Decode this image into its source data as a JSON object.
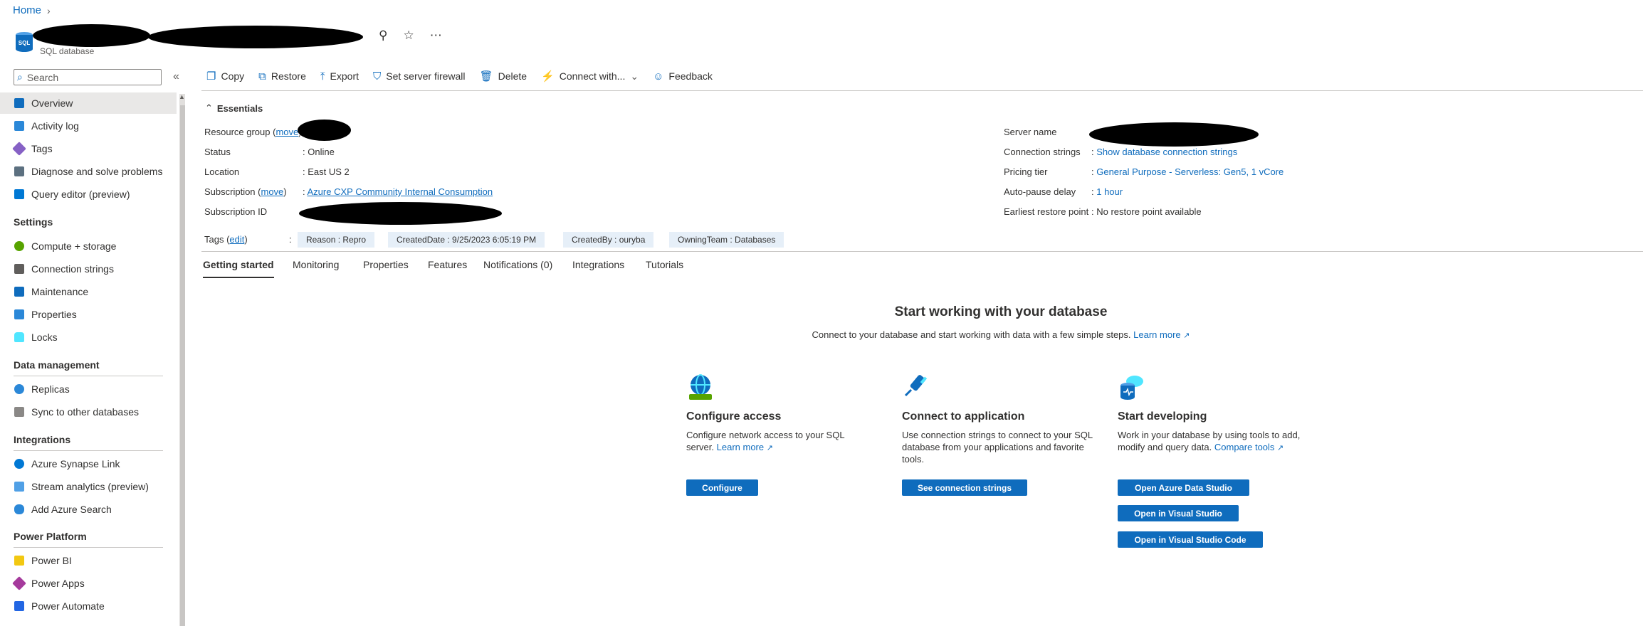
{
  "breadcrumb": {
    "home": "Home"
  },
  "resource": {
    "type_label": "SQL database"
  },
  "sidebar": {
    "search_placeholder": "Search",
    "top_items": [
      {
        "label": "Overview",
        "icon": "sql-icon"
      },
      {
        "label": "Activity log",
        "icon": "log-icon"
      },
      {
        "label": "Tags",
        "icon": "tag-icon"
      },
      {
        "label": "Diagnose and solve problems",
        "icon": "wrench-icon"
      },
      {
        "label": "Query editor (preview)",
        "icon": "query-icon"
      }
    ],
    "sections": [
      {
        "title": "Settings",
        "items": [
          "Compute + storage",
          "Connection strings",
          "Maintenance",
          "Properties",
          "Locks"
        ]
      },
      {
        "title": "Data management",
        "items": [
          "Replicas",
          "Sync to other databases"
        ]
      },
      {
        "title": "Integrations",
        "items": [
          "Azure Synapse Link",
          "Stream analytics (preview)",
          "Add Azure Search"
        ]
      },
      {
        "title": "Power Platform",
        "items": [
          "Power BI",
          "Power Apps",
          "Power Automate"
        ]
      }
    ]
  },
  "toolbar": {
    "copy": "Copy",
    "restore": "Restore",
    "export": "Export",
    "firewall": "Set server firewall",
    "delete": "Delete",
    "connect": "Connect with...",
    "feedback": "Feedback"
  },
  "essentials": {
    "heading": "Essentials",
    "resource_group_label": "Resource group",
    "move": "move",
    "status_label": "Status",
    "status": "Online",
    "location_label": "Location",
    "location": "East US 2",
    "subscription_label": "Subscription",
    "subscription": "Azure CXP Community Internal Consumption",
    "subscription_id_label": "Subscription ID",
    "server_name_label": "Server name",
    "conn_label": "Connection strings",
    "conn": "Show database connection strings",
    "pricing_label": "Pricing tier",
    "pricing": "General Purpose - Serverless: Gen5, 1 vCore",
    "autopause_label": "Auto-pause delay",
    "autopause": "1 hour",
    "restore_label": "Earliest restore point",
    "restore": "No restore point available",
    "tags_label": "Tags",
    "edit": "edit",
    "tags": [
      "Reason : Repro",
      "CreatedDate : 9/25/2023 6:05:19 PM",
      "CreatedBy : ouryba",
      "OwningTeam : Databases"
    ]
  },
  "tabs": [
    "Getting started",
    "Monitoring",
    "Properties",
    "Features",
    "Notifications (0)",
    "Integrations",
    "Tutorials"
  ],
  "getting_started": {
    "title": "Start working with your database",
    "subtitle": "Connect to your database and start working with data with a few simple steps.",
    "learn_more": "Learn more",
    "cards": [
      {
        "title": "Configure access",
        "desc1": "Configure network access to your SQL",
        "desc2": "server.",
        "link": "Learn more",
        "buttons": [
          "Configure"
        ]
      },
      {
        "title": "Connect to application",
        "desc1": "Use connection strings to connect to your SQL",
        "desc2": "database from your applications and favorite",
        "desc3": "tools.",
        "buttons": [
          "See connection strings"
        ]
      },
      {
        "title": "Start developing",
        "desc1": "Work in your database by using tools to add,",
        "desc2": "modify and query data.",
        "link": "Compare tools",
        "buttons": [
          "Open Azure Data Studio",
          "Open in Visual Studio",
          "Open in Visual Studio Code"
        ]
      }
    ]
  },
  "colors": {
    "accent": "#0f6cbd",
    "selected": "#e9e8e7",
    "tag_bg": "#e6eff8"
  }
}
